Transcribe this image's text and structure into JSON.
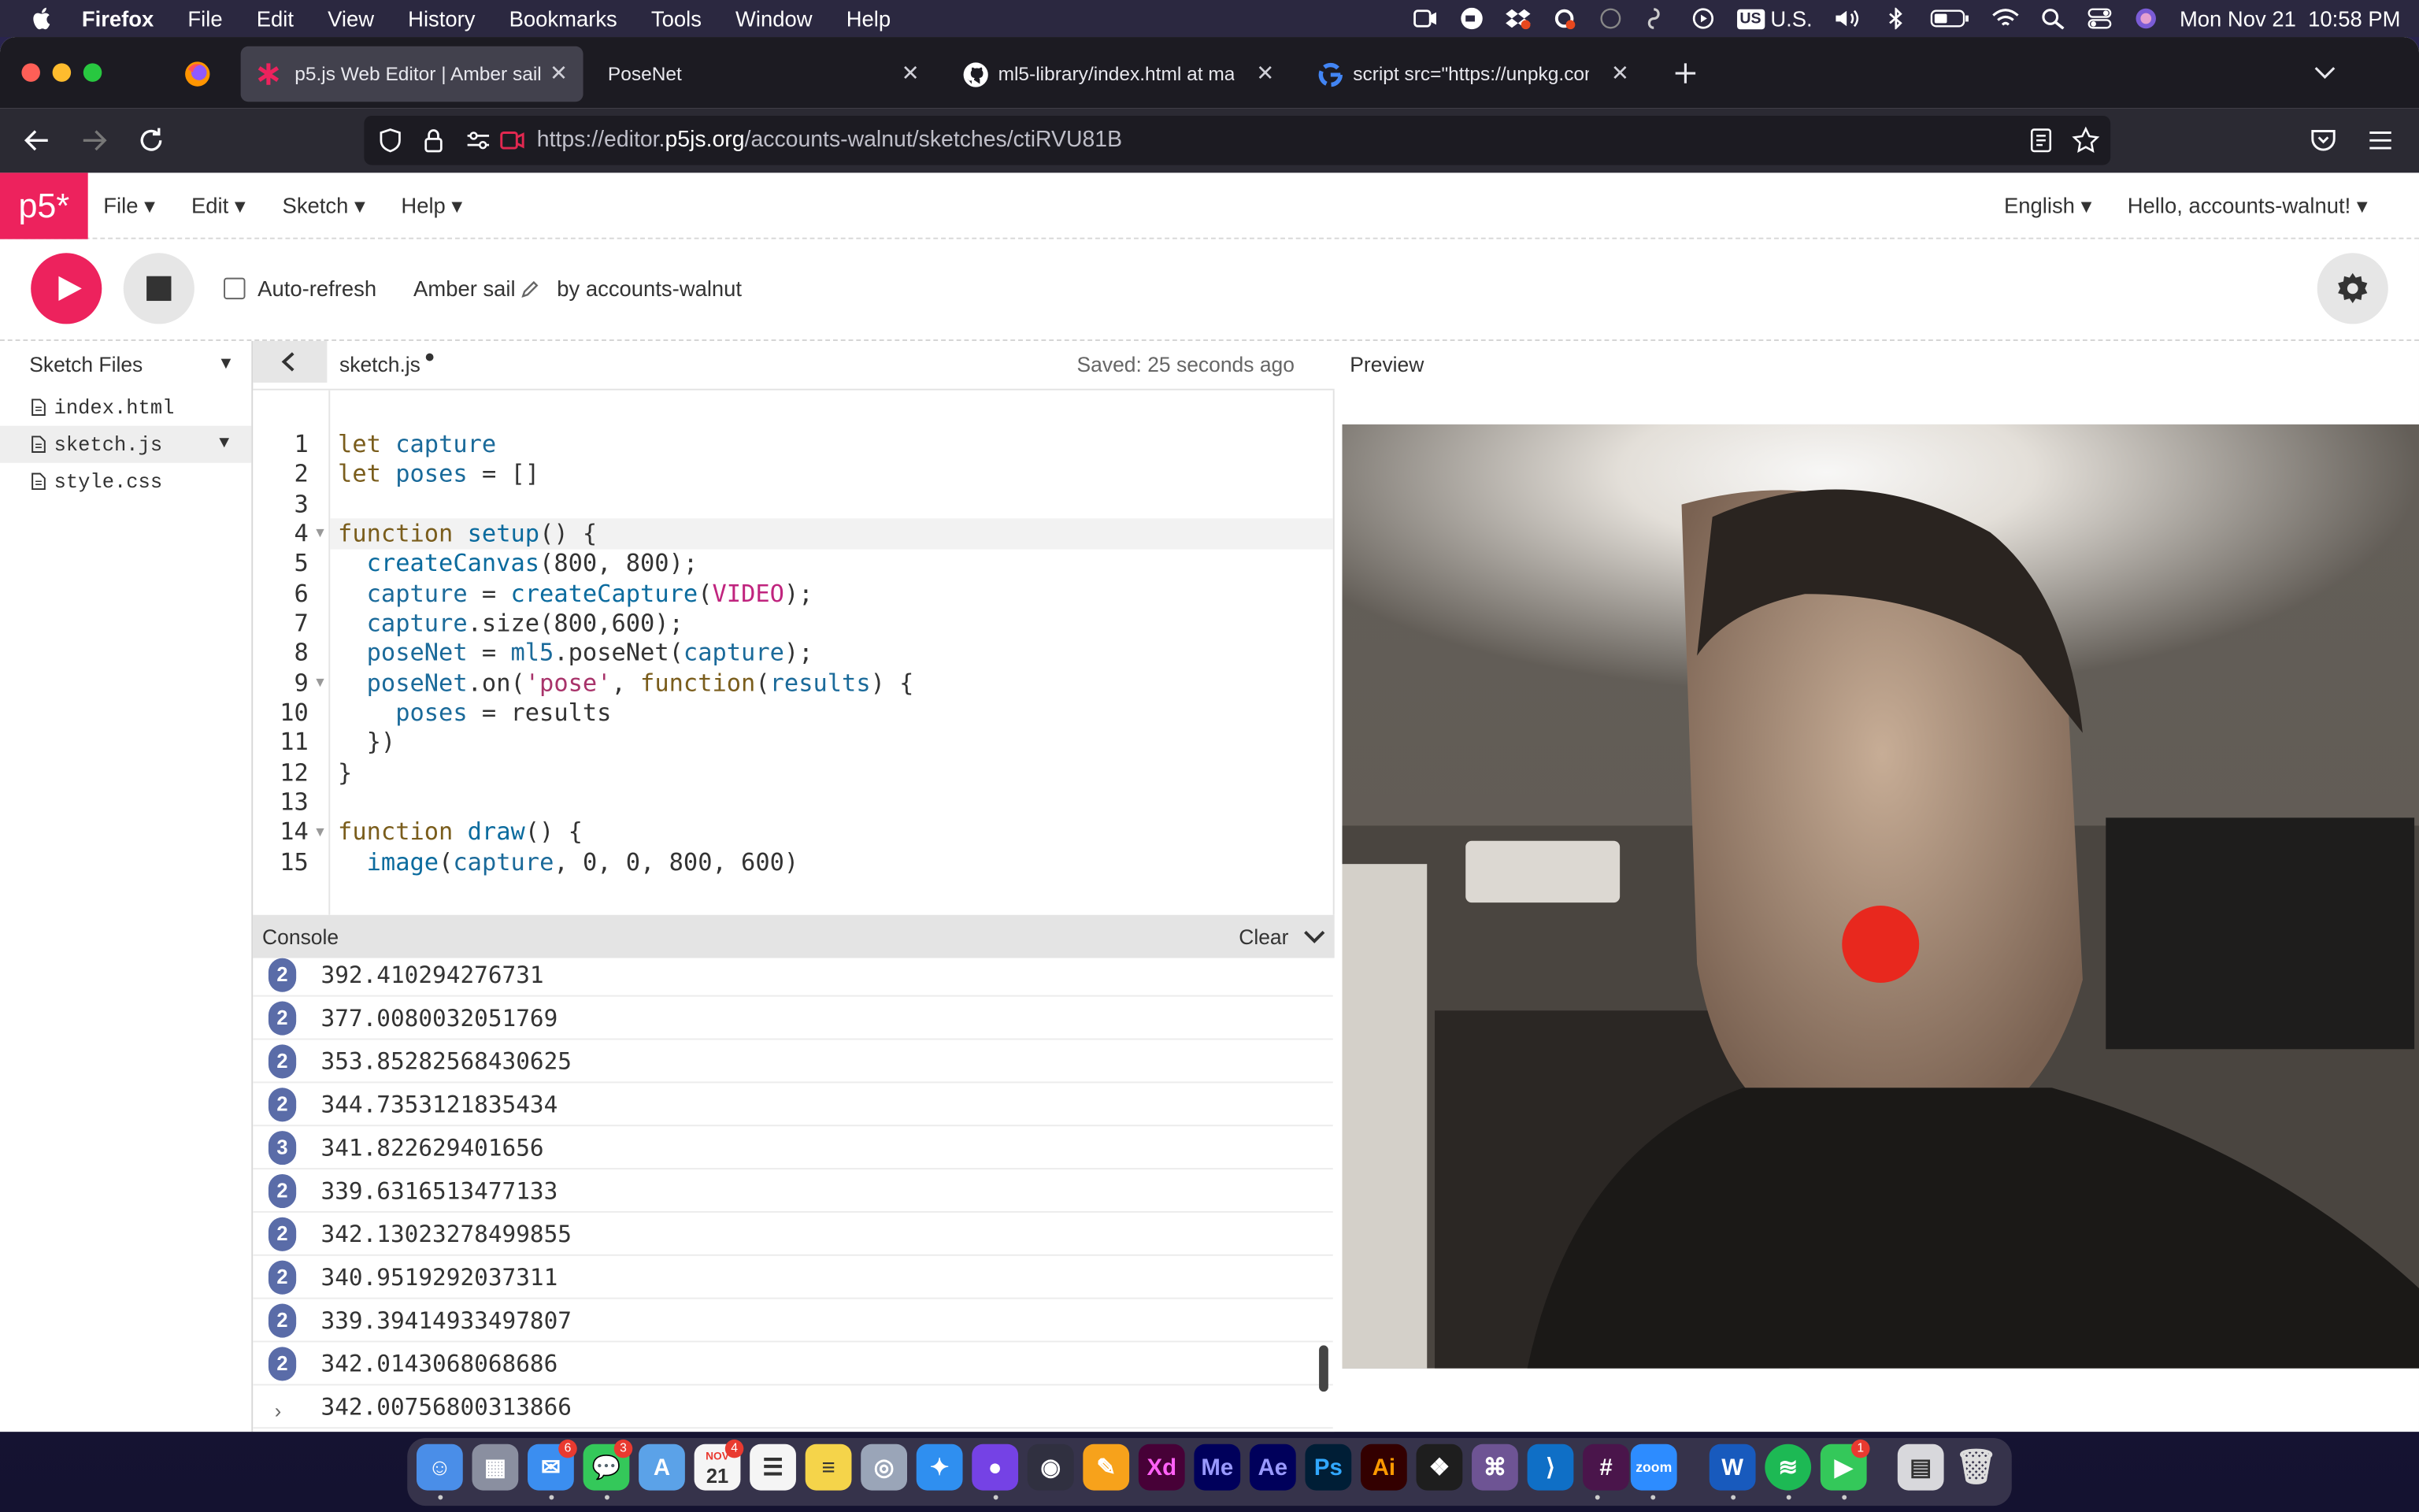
{
  "menubar": {
    "app_name": "Firefox",
    "items": [
      "File",
      "Edit",
      "View",
      "History",
      "Bookmarks",
      "Tools",
      "Window",
      "Help"
    ],
    "input_source": "U.S.",
    "datetime": "Mon Nov 21  10:58 PM"
  },
  "browser": {
    "tabs": [
      {
        "title": "p5.js Web Editor | Amber sail",
        "active": true
      },
      {
        "title": "PoseNet",
        "active": false
      },
      {
        "title": "ml5-library/index.html at main · ",
        "active": false
      },
      {
        "title": "script src=\"https://unpkg.com/m",
        "active": false
      }
    ],
    "url_prefix": "https://editor.",
    "url_domain": "p5js.org",
    "url_path": "/accounts-walnut/sketches/ctiRVU81B"
  },
  "p5": {
    "logo": "p5*",
    "menu": [
      "File",
      "Edit",
      "Sketch",
      "Help"
    ],
    "language": "English",
    "greeting": "Hello, accounts-walnut!",
    "auto_refresh_label": "Auto-refresh",
    "sketch_name": "Amber sail",
    "author": "by accounts-walnut",
    "sidebar_title": "Sketch Files",
    "files": [
      "index.html",
      "sketch.js",
      "style.css"
    ],
    "editor_filename": "sketch.js",
    "saved_status": "Saved: 25 seconds ago",
    "preview_label": "Preview",
    "console_label": "Console",
    "clear_label": "Clear",
    "line_numbers": [
      "1",
      "2",
      "3",
      "4",
      "5",
      "6",
      "7",
      "8",
      "9",
      "10",
      "11",
      "12",
      "13",
      "14",
      "15"
    ],
    "console_rows": [
      {
        "count": "2",
        "value": "392.410294276731"
      },
      {
        "count": "2",
        "value": "377.0080032051769"
      },
      {
        "count": "2",
        "value": "353.85282568430625"
      },
      {
        "count": "2",
        "value": "344.7353121835434"
      },
      {
        "count": "3",
        "value": "341.822629401656"
      },
      {
        "count": "2",
        "value": "339.6316513477133"
      },
      {
        "count": "2",
        "value": "342.13023278499855"
      },
      {
        "count": "2",
        "value": "340.9519292037311"
      },
      {
        "count": "2",
        "value": "339.39414933497807"
      },
      {
        "count": "2",
        "value": "342.0143068068686"
      },
      {
        "count": "",
        "value": "342.00756800313866"
      }
    ]
  },
  "code": {
    "l1": [
      "let",
      "capture"
    ],
    "l2": [
      "let",
      "poses",
      "= []"
    ],
    "l4": [
      "function",
      "setup",
      "() {"
    ],
    "l5": [
      "createCanvas",
      "(800, 800);"
    ],
    "l6": [
      "capture",
      " = ",
      "createCapture",
      "(",
      "VIDEO",
      ");"
    ],
    "l7": [
      "capture",
      ".size(800,600);"
    ],
    "l8": [
      "poseNet",
      " = ",
      "ml5",
      ".poseNet(",
      "capture",
      ");"
    ],
    "l9": [
      "poseNet",
      ".on(",
      "'pose'",
      ", ",
      "function",
      "(",
      "results",
      ") {"
    ],
    "l10": [
      "poses",
      " = results"
    ],
    "l11": "})",
    "l12": "}",
    "l14": [
      "function",
      "draw",
      "() {"
    ],
    "l15": [
      "image",
      "(",
      "capture",
      ", 0, 0, 800, 600)"
    ]
  },
  "dock": {
    "calendar_month": "NOV",
    "calendar_day": "21",
    "mail_badge": "6",
    "messages_badge": "3",
    "calendar_badge": "4",
    "facetime_badge": "1",
    "labels": {
      "xd": "Xd",
      "me": "Me",
      "ae": "Ae",
      "ps": "Ps",
      "ai": "Ai",
      "zoom": "zoom"
    }
  },
  "colors": {
    "p5_pink": "#ed225d",
    "nose_dot": "#e8281e",
    "console_badge": "#5a6ca8"
  }
}
